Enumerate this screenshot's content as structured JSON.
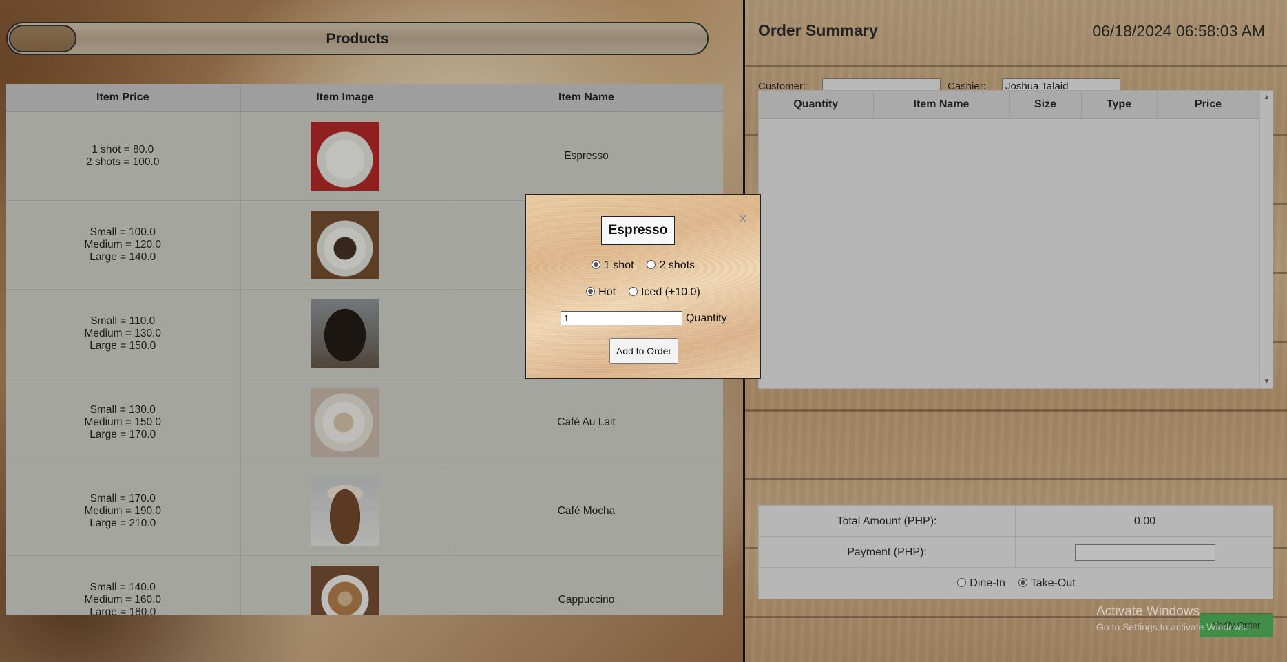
{
  "products": {
    "title": "Products",
    "headers": [
      "Item Price",
      "Item Image",
      "Item Name"
    ],
    "rows": [
      {
        "price_lines": [
          "1 shot = 80.0",
          "2 shots = 100.0",
          ""
        ],
        "image": "espresso-image",
        "name": "Espresso"
      },
      {
        "price_lines": [
          "Small = 100.0",
          "Medium = 120.0",
          "Large = 140.0"
        ],
        "image": "coffee-cup-beans-image",
        "name": ""
      },
      {
        "price_lines": [
          "Small = 110.0",
          "Medium = 130.0",
          "Large = 150.0"
        ],
        "image": "black-coffee-glass-image",
        "name": ""
      },
      {
        "price_lines": [
          "Small = 130.0",
          "Medium = 150.0",
          "Large = 170.0"
        ],
        "image": "cafe-au-lait-image",
        "name": "Café Au Lait"
      },
      {
        "price_lines": [
          "Small = 170.0",
          "Medium = 190.0",
          "Large = 210.0"
        ],
        "image": "cafe-mocha-image",
        "name": "Café Mocha"
      },
      {
        "price_lines": [
          "Small = 140.0",
          "Medium = 160.0",
          "Large = 180.0"
        ],
        "image": "cappuccino-image",
        "name": "Cappuccino"
      }
    ]
  },
  "order": {
    "title": "Order Summary",
    "datetime": "06/18/2024 06:58:03 AM",
    "customer_label": "Customer:",
    "customer_value": "",
    "cashier_label": "Cashier:",
    "cashier_value": "Joshua Talaid",
    "headers": [
      "Quantity",
      "Item Name",
      "Size",
      "Type",
      "Price"
    ],
    "total_label": "Total Amount (PHP):",
    "total_value": "0.00",
    "payment_label": "Payment (PHP):",
    "payment_value": "",
    "dine_in_label": "Dine-In",
    "take_out_label": "Take-Out",
    "verify_label": "Verify Order"
  },
  "modal": {
    "title": "Espresso",
    "close_glyph": "×",
    "shot_options": [
      "1 shot",
      "2 shots"
    ],
    "temp_options": [
      "Hot",
      "Iced (+10.0)"
    ],
    "quantity_value": "1",
    "quantity_label": "Quantity",
    "add_label": "Add to Order"
  },
  "watermark": {
    "title": "Activate Windows",
    "subtitle": "Go to Settings to activate Windows."
  }
}
